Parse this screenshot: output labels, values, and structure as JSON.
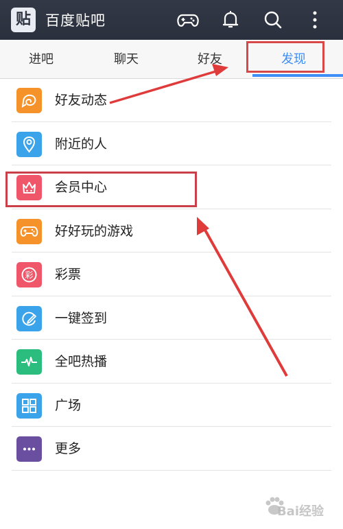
{
  "header": {
    "logo_char": "贴",
    "title": "百度贴吧",
    "icons": [
      "gamepad-icon",
      "bell-icon",
      "search-icon",
      "more-icon"
    ]
  },
  "tabs": [
    {
      "label": "进吧"
    },
    {
      "label": "聊天"
    },
    {
      "label": "好友"
    },
    {
      "label": "发现",
      "active": true
    }
  ],
  "list": [
    {
      "label": "好友动态",
      "icon": "friend-feed-icon",
      "color": "#f5922a"
    },
    {
      "label": "附近的人",
      "icon": "location-pin-icon",
      "color": "#3aa3ea"
    },
    {
      "label": "会员中心",
      "icon": "crown-icon",
      "color": "#f0566a"
    },
    {
      "label": "好好玩的游戏",
      "icon": "gamepad-icon",
      "color": "#f5922a"
    },
    {
      "label": "彩票",
      "icon": "lottery-icon",
      "color": "#f0566a",
      "glyph": "彩"
    },
    {
      "label": "一键签到",
      "icon": "sign-in-icon",
      "color": "#3aa3ea"
    },
    {
      "label": "全吧热播",
      "icon": "pulse-icon",
      "color": "#2bbd7e"
    },
    {
      "label": "广场",
      "icon": "grid-icon",
      "color": "#3aa3ea"
    },
    {
      "label": "更多",
      "icon": "more-dots-icon",
      "color": "#6a4fa0"
    }
  ],
  "colors": {
    "header_bg": "#2e3440",
    "accent": "#3e8ef7",
    "annotation_red": "#d94848"
  },
  "watermark": {
    "text": "Bai经验"
  }
}
